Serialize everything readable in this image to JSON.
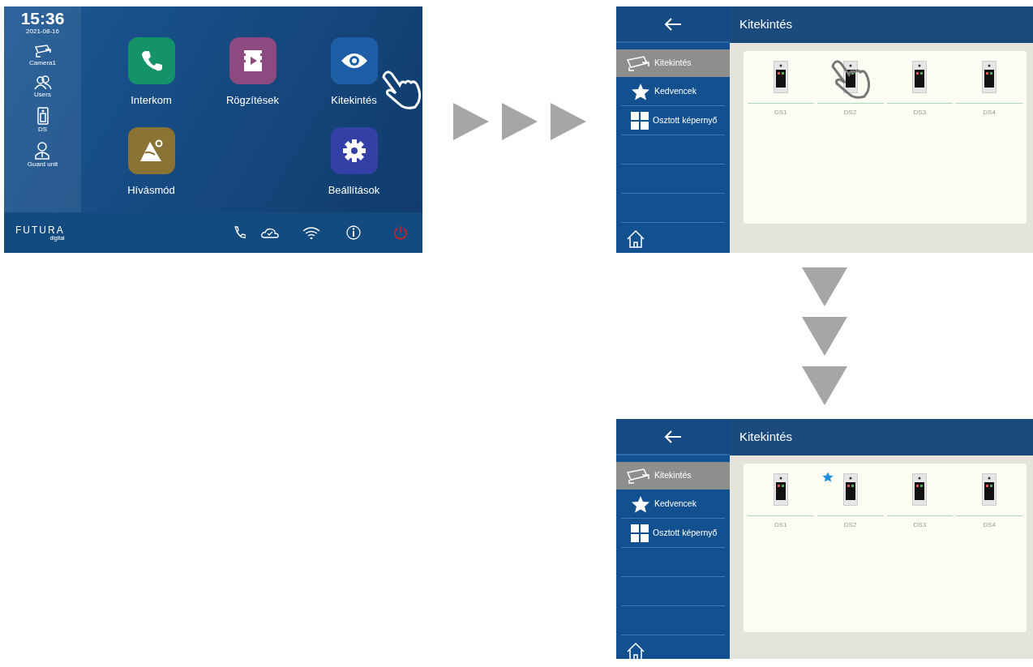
{
  "home_screen": {
    "clock": "15:36",
    "date": "2021-08-16",
    "sidebar": [
      {
        "kind": "camera",
        "label": "Camera1"
      },
      {
        "kind": "users",
        "label": "Users"
      },
      {
        "kind": "door",
        "label": "DS"
      },
      {
        "kind": "guard",
        "label": "Guard unit"
      }
    ],
    "apps": [
      {
        "kind": "phone",
        "label": "Interkom",
        "color": "#14936b",
        "tapped": false
      },
      {
        "kind": "film",
        "label": "Rögzítések",
        "color": "#8c4a80",
        "tapped": false
      },
      {
        "kind": "eye",
        "label": "Kitekintés",
        "color": "#1d5ea6",
        "tapped": true
      },
      {
        "kind": "mountain",
        "label": "Hívásmód",
        "color": "#8b7235",
        "tapped": false
      },
      {
        "kind": "gear",
        "label": "Beállítások",
        "color": "#3540a6",
        "tapped": false
      }
    ],
    "logo": {
      "name": "FUTURA",
      "sub": "digital"
    }
  },
  "monitor_screens": [
    {
      "title": "Kitekintés",
      "menu": [
        {
          "kind": "camera",
          "label": "Kitekintés",
          "selected": true
        },
        {
          "kind": "star",
          "label": "Kedvencek",
          "selected": false
        },
        {
          "kind": "grid",
          "label": "Osztott képernyő",
          "selected": false
        }
      ],
      "devices": [
        {
          "label": "DS1",
          "favorite": false,
          "tapped": false
        },
        {
          "label": "DS2",
          "favorite": false,
          "tapped": true
        },
        {
          "label": "DS3",
          "favorite": false,
          "tapped": false
        },
        {
          "label": "DS4",
          "favorite": false,
          "tapped": false
        }
      ]
    },
    {
      "title": "Kitekintés",
      "menu": [
        {
          "kind": "camera",
          "label": "Kitekintés",
          "selected": true
        },
        {
          "kind": "star",
          "label": "Kedvencek",
          "selected": false
        },
        {
          "kind": "grid",
          "label": "Osztott képernyő",
          "selected": false
        }
      ],
      "devices": [
        {
          "label": "DS1",
          "favorite": false,
          "tapped": false
        },
        {
          "label": "DS2",
          "favorite": true,
          "tapped": false
        },
        {
          "label": "DS3",
          "favorite": false,
          "tapped": false
        },
        {
          "label": "DS4",
          "favorite": false,
          "tapped": false
        }
      ]
    }
  ]
}
